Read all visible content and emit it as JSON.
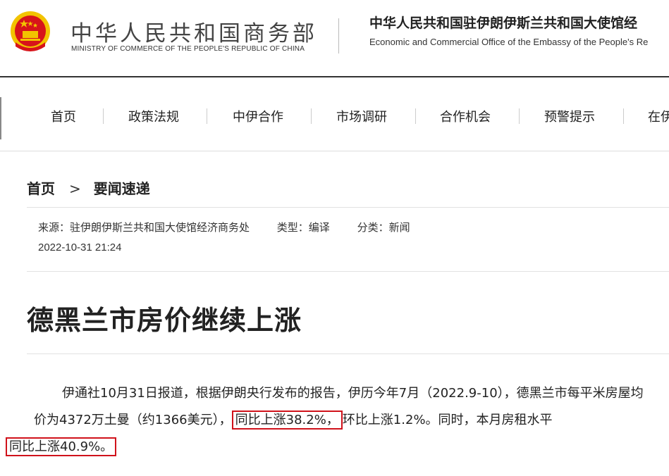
{
  "header": {
    "ministry_cn": "中华人民共和国商务部",
    "ministry_en": "MINISTRY OF COMMERCE OF THE PEOPLE'S REPUBLIC OF CHINA",
    "office_cn": "中华人民共和国驻伊朗伊斯兰共和国大使馆经",
    "office_en": "Economic and Commercial Office of the Embassy of the People's Re",
    "emblem_color": "#d7141a",
    "emblem_gold": "#f2c300"
  },
  "nav": {
    "items": [
      "首页",
      "政策法规",
      "中伊合作",
      "市场调研",
      "合作机会",
      "预警提示",
      "在伊"
    ]
  },
  "breadcrumb": {
    "home": "首页",
    "arrow": ">",
    "section": "要闻速递"
  },
  "meta": {
    "source": "来源：驻伊朗伊斯兰共和国大使馆经济商务处",
    "type": "类型：编译",
    "category": "分类：新闻",
    "date": "2022-10-31 21:24"
  },
  "article": {
    "title": "德黑兰市房价继续上涨",
    "p1_a": "伊通社10月31日报道，根据伊朗央行发布的报告，伊历今年7月（2022.9-10），德黑兰市每平米房屋均价为4372万土曼（约1366美元），",
    "p1_hl1": "同比上涨38.2%，",
    "p1_b": "环比上涨1.2%。同时，本月房租水平",
    "p1_hl2": "同比上涨40.9%。",
    "highlight_color": "#d0121b"
  }
}
